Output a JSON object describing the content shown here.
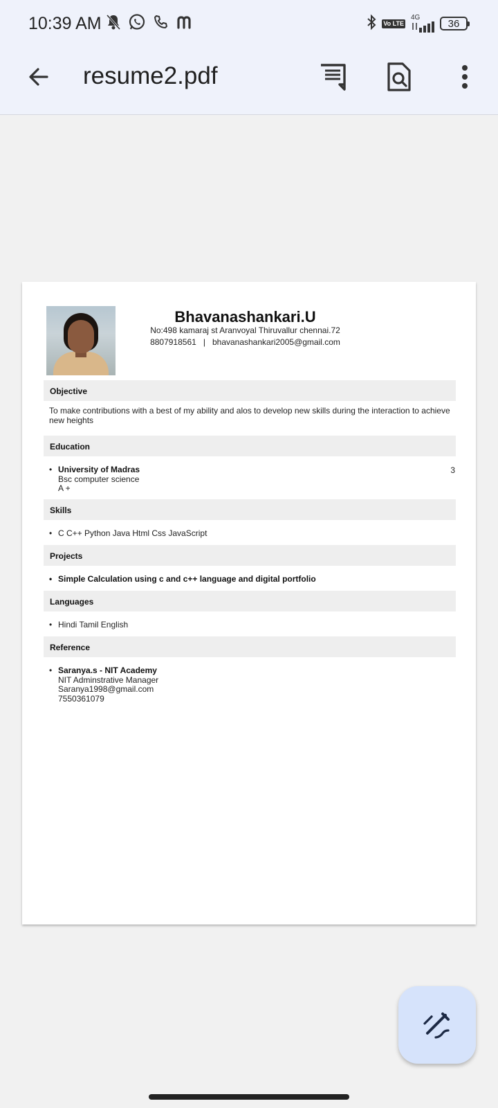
{
  "status_bar": {
    "time": "10:39 AM",
    "network": "4G",
    "volte": "Vo LTE",
    "battery": "36"
  },
  "app_bar": {
    "title": "resume2.pdf"
  },
  "resume": {
    "name": "Bhavanashankari.U",
    "address": "No:498 kamaraj st Aranvoyal Thiruvallur chennai.72",
    "phone": "8807918561",
    "separator": "|",
    "email": "bhavanashankari2005@gmail.com",
    "sections": {
      "objective": {
        "heading": "Objective",
        "text": "To make contributions with a best of my ability and alos to develop new skills during the interaction to achieve new heights"
      },
      "education": {
        "heading": "Education",
        "institution": "University of Madras",
        "degree": "Bsc computer science",
        "grade": "A +",
        "right_value": "3"
      },
      "skills": {
        "heading": "Skills",
        "text": "C C++ Python Java Html Css JavaScript"
      },
      "projects": {
        "heading": "Projects",
        "text": "Simple Calculation using c and c++ language and digital portfolio"
      },
      "languages": {
        "heading": "Languages",
        "text": "Hindi Tamil English"
      },
      "reference": {
        "heading": "Reference",
        "name": "Saranya.s - NIT Academy",
        "role": "NIT Adminstrative Manager",
        "email": "Saranya1998@gmail.com",
        "phone": "7550361079"
      }
    }
  }
}
